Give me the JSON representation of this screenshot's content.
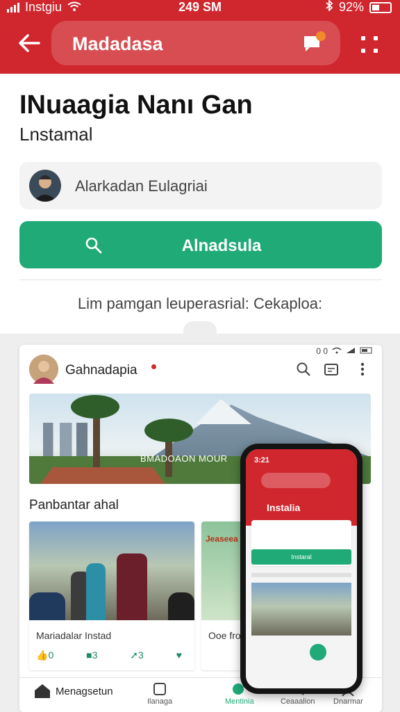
{
  "status_bar": {
    "carrier": "Instgiu",
    "time": "249 SM",
    "battery": "92%"
  },
  "header": {
    "search_value": "Madadasa",
    "back_icon": "arrow-left-icon",
    "chat_icon": "chat-bubble-icon",
    "more_icon": "grid-dots-icon",
    "brand_color": "#d0262d"
  },
  "page": {
    "title": "INuaagia Nanı Gan",
    "subtitle": "Lnstamal",
    "account_name": "Alarkadan Eulagriai",
    "primary_button_label": "Alnadsula",
    "primary_button_color": "#1faa78",
    "caption": "Lim pamgan leuperasrial: Cekaploa:"
  },
  "preview": {
    "mini_status": "0 0",
    "feed_name": "Gahnadapia",
    "banner_label": "BMADOAON MOUR",
    "section_title": "Panbantar ahal",
    "post1_title": "Mariadalar Instad",
    "post1_actions": [
      "0",
      "3",
      "3",
      ""
    ],
    "post2_title": "Ooe froo",
    "post2_tag": "Jeaseea",
    "phone_time": "3:21",
    "phone_title": "Instalia",
    "phone_button": "Instaral"
  },
  "bottom_nav": {
    "items": [
      "Menagsetun",
      "Ilanaga",
      "Mentinia",
      "Ceaaalion",
      "Dnarmar"
    ]
  }
}
